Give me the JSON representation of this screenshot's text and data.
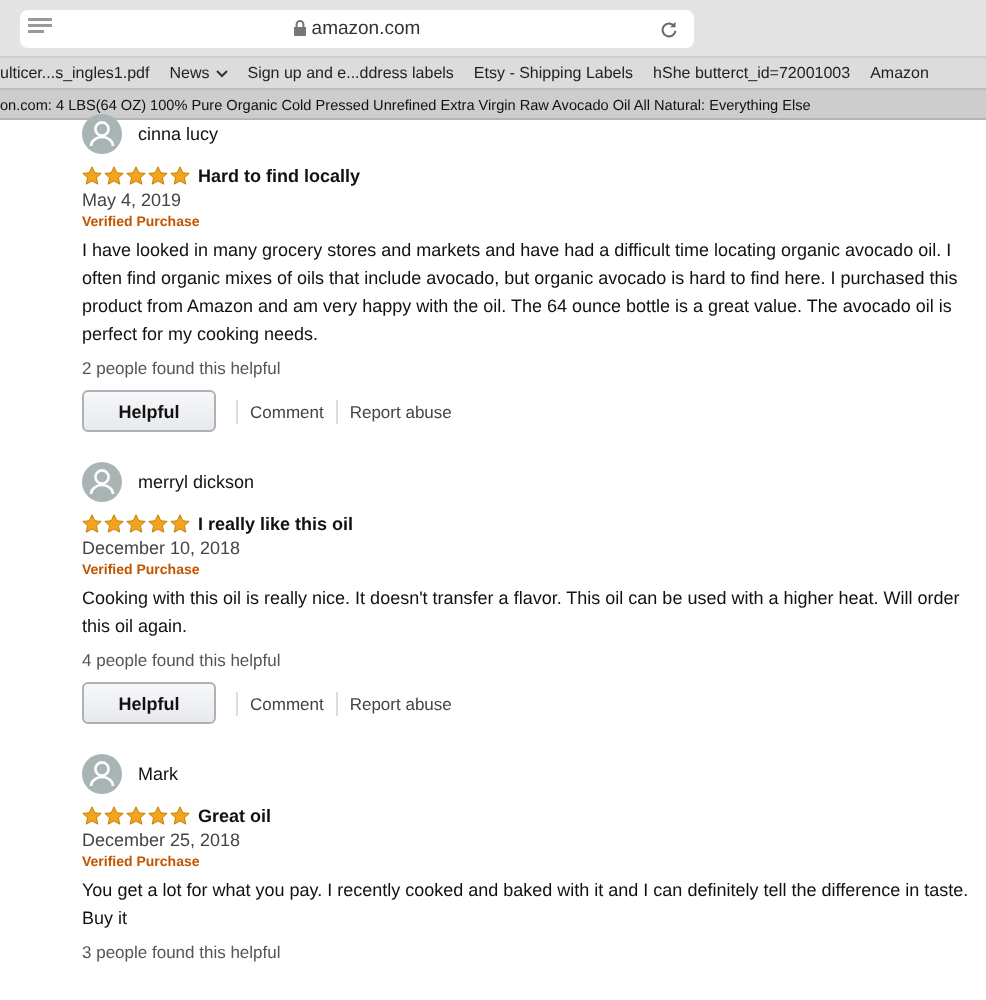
{
  "browser": {
    "address": "amazon.com",
    "bookmarks": [
      {
        "label": "ulticer...s_ingles1.pdf",
        "kind": "link"
      },
      {
        "label": "News",
        "kind": "menu"
      },
      {
        "label": "Sign up and e...ddress labels",
        "kind": "link"
      },
      {
        "label": "Etsy - Shipping Labels",
        "kind": "link"
      },
      {
        "label": "hShe butterct_id=72001003",
        "kind": "link"
      },
      {
        "label": "Amazon",
        "kind": "link"
      }
    ],
    "tab_title": "on.com: 4 LBS(64 OZ) 100% Pure Organic Cold Pressed Unrefined Extra Virgin Raw Avocado Oil All Natural: Everything Else"
  },
  "reviews": [
    {
      "author": "cinna lucy",
      "stars": 5,
      "title": "Hard to find locally",
      "date": "May 4, 2019",
      "badge": "Verified Purchase",
      "body": "I have looked in many grocery stores and markets and have had a difficult time locating organic avocado oil. I often find organic mixes of oils that include avocado, but organic avocado is hard to find here. I purchased this product from Amazon and am very happy with the oil. The 64 ounce bottle is a great value. The avocado oil is perfect for my cooking needs.",
      "helpful_count": "2 people found this helpful",
      "actions": [
        "Helpful",
        "Comment",
        "Report abuse"
      ]
    },
    {
      "author": "merryl dickson",
      "stars": 5,
      "title": "I really like this oil",
      "date": "December 10, 2018",
      "badge": "Verified Purchase",
      "body": "Cooking with this oil is really nice. It doesn't transfer a flavor. This oil can be used with a higher heat. Will order this oil again.",
      "helpful_count": "4 people found this helpful",
      "actions": [
        "Helpful",
        "Comment",
        "Report abuse"
      ]
    },
    {
      "author": "Mark",
      "stars": 5,
      "title": "Great oil",
      "date": "December 25, 2018",
      "badge": "Verified Purchase",
      "body": "You get a lot for what you pay. I recently cooked and baked with it and I can definitely tell the difference in taste. Buy it",
      "helpful_count": "3 people found this helpful"
    }
  ]
}
